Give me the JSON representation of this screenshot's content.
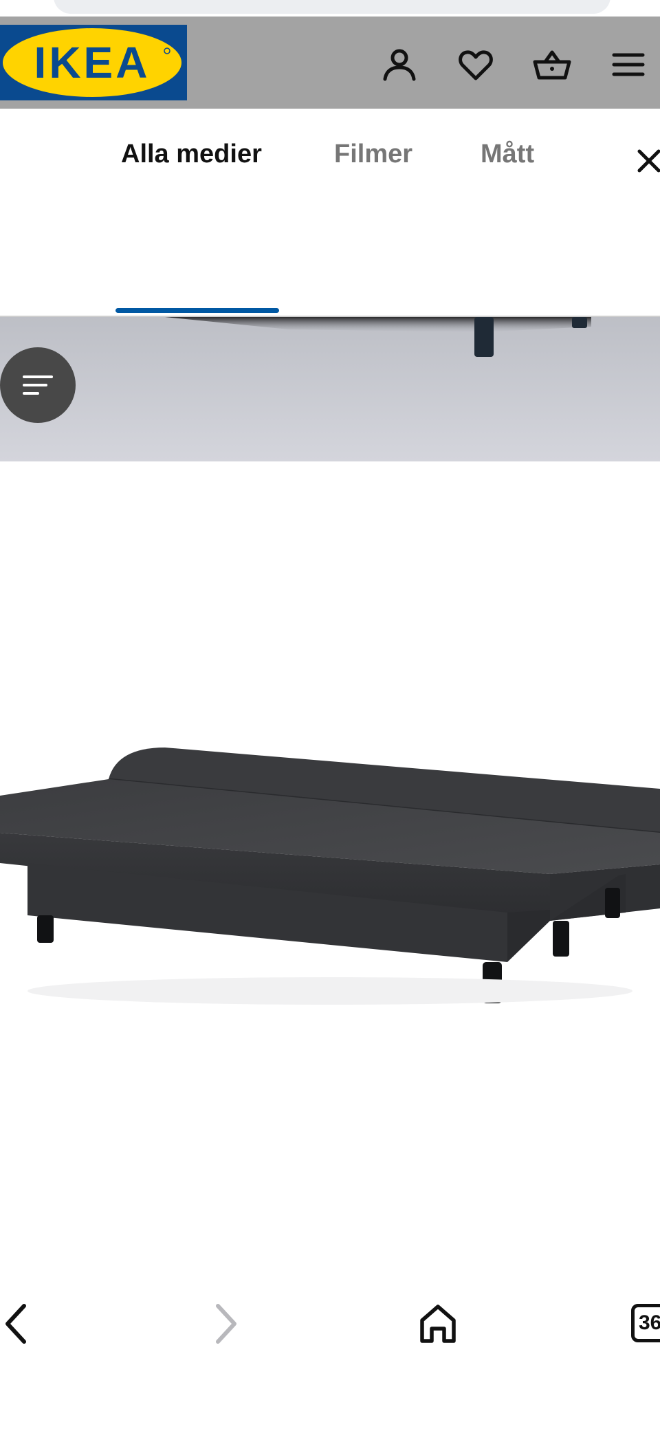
{
  "header": {
    "logo_text": "IKEA",
    "brand_colors": {
      "blue": "#0058a3",
      "yellow": "#ffdb00"
    },
    "icons": [
      "account-icon",
      "heart-icon",
      "basket-icon",
      "menu-icon"
    ]
  },
  "media_tabs": {
    "items": [
      {
        "label": "Alla medier",
        "active": true
      },
      {
        "label": "Filmer",
        "active": false
      },
      {
        "label": "Mått",
        "active": false
      }
    ],
    "accent_color": "#0058a3"
  },
  "browser_bar": {
    "tab_count": "36"
  }
}
